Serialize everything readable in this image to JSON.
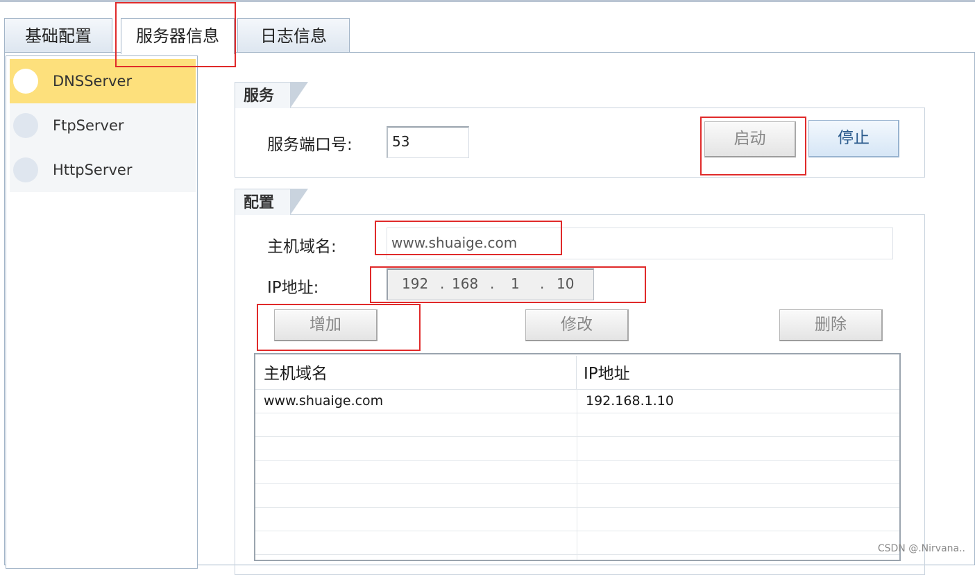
{
  "tabs": [
    {
      "label": "基础配置"
    },
    {
      "label": "服务器信息"
    },
    {
      "label": "日志信息"
    }
  ],
  "server_list": {
    "items": [
      {
        "label": "DNSServer",
        "selected": true
      },
      {
        "label": "FtpServer",
        "selected": false
      },
      {
        "label": "HttpServer",
        "selected": false
      }
    ]
  },
  "service_group": {
    "title": "服务",
    "port_label": "服务端口号:",
    "port_value": "53",
    "start_label": "启动",
    "stop_label": "停止"
  },
  "config_group": {
    "title": "配置",
    "hostname_label": "主机域名:",
    "hostname_value": "www.shuaige.com",
    "ip_label": "IP地址:",
    "ip_octets": [
      "192",
      "168",
      "1",
      "10"
    ],
    "add_label": "增加",
    "edit_label": "修改",
    "delete_label": "删除"
  },
  "table": {
    "columns": [
      "主机域名",
      "IP地址"
    ],
    "rows": [
      [
        "www.shuaige.com",
        "192.168.1.10"
      ]
    ]
  },
  "watermark": "CSDN @.Nirvana..",
  "colors": {
    "selected_item": "#fde07c",
    "highlight_box": "#e02a2a",
    "tab_border": "#a3b5c8"
  }
}
